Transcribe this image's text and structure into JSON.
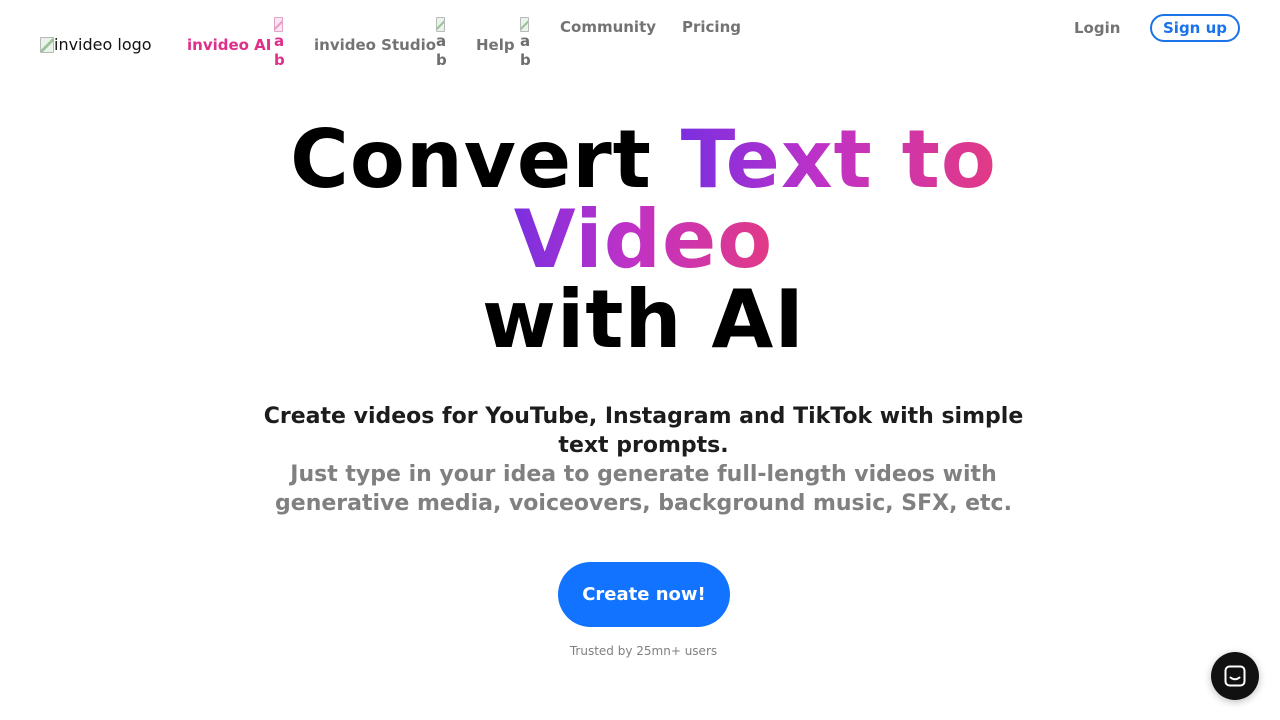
{
  "header": {
    "logo_alt": "invideo logo",
    "nav": {
      "invideo_ai": "invideo AI",
      "invideo_studio": "invideo Studio",
      "help": "Help",
      "community": "Community",
      "pricing": "Pricing"
    },
    "alt_fragments": [
      "a",
      "b"
    ],
    "login": "Login",
    "signup": "Sign up"
  },
  "hero": {
    "title_part1": "Convert ",
    "title_highlight_line1": "Text to",
    "title_highlight_line2": "Video",
    "title_line3": "with AI",
    "subtitle": "Create videos for YouTube, Instagram and TikTok with simple text prompts.",
    "description": "Just type in your idea to generate full-length videos with generative media, voiceovers, background music, SFX, etc.",
    "cta": "Create now!",
    "trusted": "Trusted by 25mn+ users"
  },
  "colors": {
    "accent_pink": "#df2f8a",
    "gradient_start": "#7b2fe0",
    "gradient_end": "#e23a84",
    "button_blue": "#1173ff",
    "link_blue": "#1a73e8"
  },
  "icons": {
    "chat": "chat-bubble-icon"
  }
}
